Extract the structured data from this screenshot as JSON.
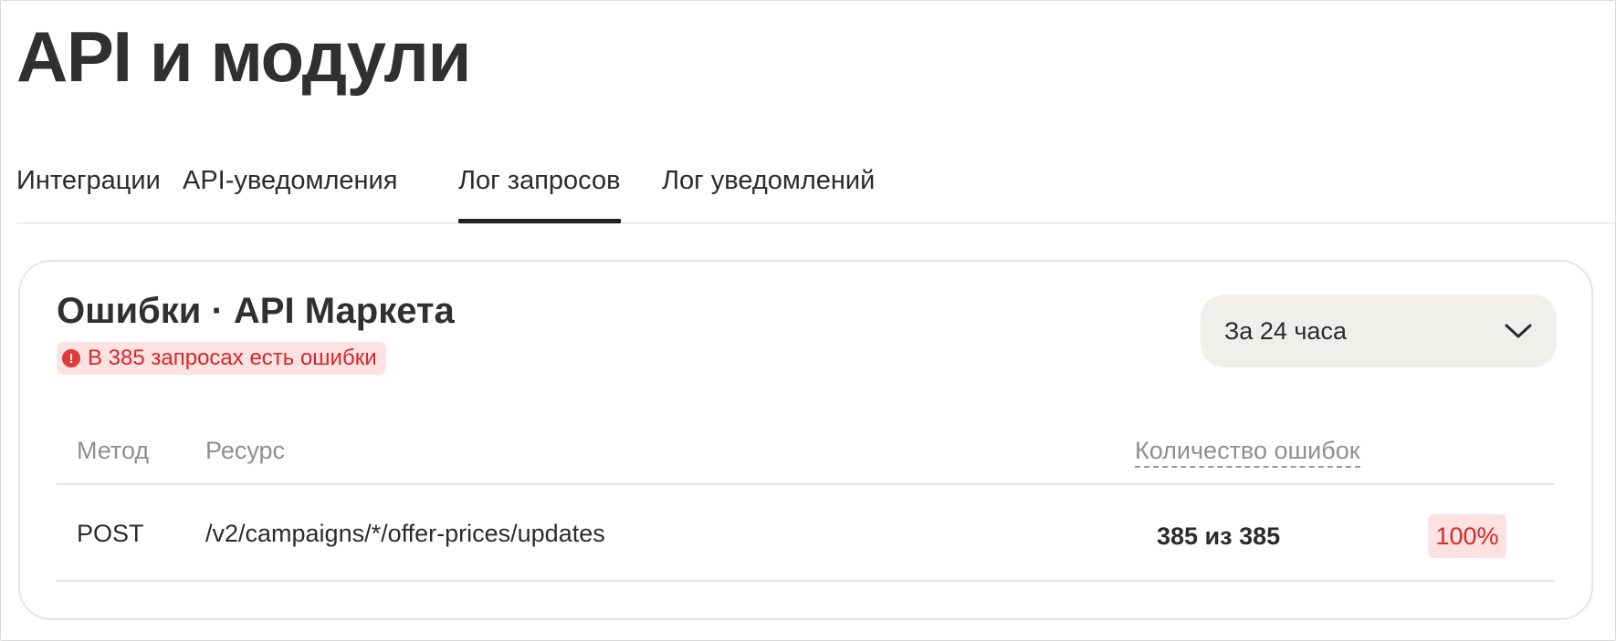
{
  "page": {
    "title": "API и модули"
  },
  "tabs": [
    {
      "label": "Интеграции",
      "active": false
    },
    {
      "label": "API-уведомления",
      "active": false
    },
    {
      "label": "Лог запросов",
      "active": true
    },
    {
      "label": "Лог уведомлений",
      "active": false
    }
  ],
  "card": {
    "title": "Ошибки · API Маркета",
    "error_badge": {
      "icon": "exclamation-circle-icon",
      "text": "В 385 запросах есть ошибки",
      "color": "#d6272b"
    },
    "period": {
      "value": "За 24 часа",
      "icon": "chevron-down-icon"
    },
    "table": {
      "headers": {
        "method": "Метод",
        "resource": "Ресурс",
        "errors": "Количество ошибок"
      },
      "rows": [
        {
          "method": "POST",
          "resource": "/v2/campaigns/*/offer-prices/updates",
          "errors": "385 из 385",
          "percent": "100%"
        }
      ]
    }
  }
}
